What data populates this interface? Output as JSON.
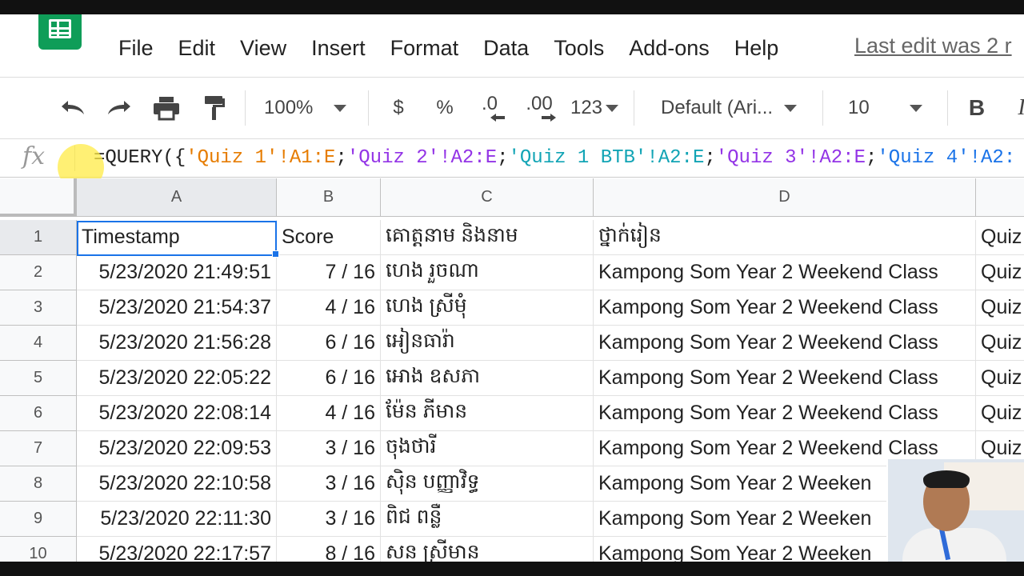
{
  "app": {
    "name": "Google Sheets"
  },
  "menu": [
    "File",
    "Edit",
    "View",
    "Insert",
    "Format",
    "Data",
    "Tools",
    "Add-ons",
    "Help"
  ],
  "last_edit": "Last edit was 2 r",
  "toolbar": {
    "zoom": "100%",
    "currency": "$",
    "percent": "%",
    "dec_decrease": ".0",
    "dec_increase": ".00",
    "number_format": "123",
    "font": "Default (Ari...",
    "font_size": "10",
    "bold": "B",
    "italic": "I"
  },
  "formula_bar": {
    "fx": "fx",
    "parts": [
      {
        "text": "=QUERY({",
        "color": "#222222"
      },
      {
        "text": "'Quiz 1'!A1:E",
        "color": "#e67c00"
      },
      {
        "text": ";",
        "color": "#222222"
      },
      {
        "text": "'Quiz 2'!A2:E",
        "color": "#9334e6"
      },
      {
        "text": ";",
        "color": "#222222"
      },
      {
        "text": "'Quiz 1 BTB'!A2:E",
        "color": "#12a4b5"
      },
      {
        "text": ";",
        "color": "#222222"
      },
      {
        "text": "'Quiz 3'!A2:E",
        "color": "#9334e6"
      },
      {
        "text": ";",
        "color": "#222222"
      },
      {
        "text": "'Quiz 4'!A2:",
        "color": "#1a73e8"
      }
    ]
  },
  "columns": [
    "A",
    "B",
    "C",
    "D",
    ""
  ],
  "rows": [
    {
      "num": "1",
      "a": "Timestamp",
      "b": "Score",
      "c": "គោត្តនាម និងនាម",
      "d": "ថ្នាក់រៀន",
      "e": "Quiz"
    },
    {
      "num": "2",
      "a": "5/23/2020 21:49:51",
      "b": "7 / 16",
      "c": "ហេង រួចណា",
      "d": "Kampong Som Year 2 Weekend Class",
      "e": "Quiz"
    },
    {
      "num": "3",
      "a": "5/23/2020 21:54:37",
      "b": "4 / 16",
      "c": "ហេង ស្រីមុំ",
      "d": "Kampong Som Year 2 Weekend Class",
      "e": "Quiz"
    },
    {
      "num": "4",
      "a": "5/23/2020 21:56:28",
      "b": "6 / 16",
      "c": "អៀនធារ៉ា",
      "d": "Kampong Som Year 2 Weekend Class",
      "e": "Quiz"
    },
    {
      "num": "5",
      "a": "5/23/2020 22:05:22",
      "b": "6 / 16",
      "c": "អោង ឧសភា",
      "d": "Kampong Som Year 2 Weekend Class",
      "e": "Quiz"
    },
    {
      "num": "6",
      "a": "5/23/2020 22:08:14",
      "b": "4 / 16",
      "c": "ម៉ែន ភីមាន",
      "d": "Kampong Som Year 2 Weekend Class",
      "e": "Quiz"
    },
    {
      "num": "7",
      "a": "5/23/2020 22:09:53",
      "b": "3 / 16",
      "c": "ចុងថារី",
      "d": "Kampong Som Year 2 Weekend Class",
      "e": "Quiz"
    },
    {
      "num": "8",
      "a": "5/23/2020 22:10:58",
      "b": "3 / 16",
      "c": "ស៊ិន បញ្ញាវិទ្ធ",
      "d": "Kampong Som Year 2 Weeken",
      "e": ""
    },
    {
      "num": "9",
      "a": "5/23/2020 22:11:30",
      "b": "3 / 16",
      "c": "ពិជ ពន្លឺ",
      "d": "Kampong Som Year 2 Weeken",
      "e": ""
    },
    {
      "num": "10",
      "a": "5/23/2020 22:17:57",
      "b": "8 / 16",
      "c": "សន ស្រីមាន",
      "d": "Kampong Som Year 2 Weeken",
      "e": ""
    }
  ]
}
